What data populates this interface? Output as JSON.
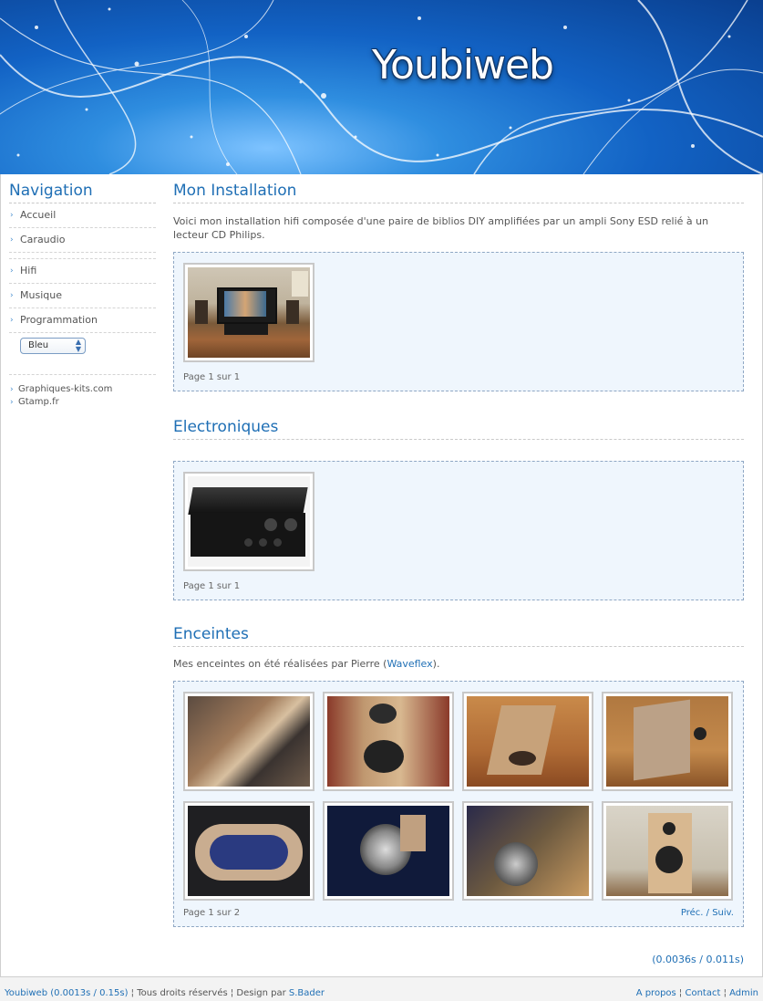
{
  "header": {
    "site_title": "Youbiweb"
  },
  "sidebar": {
    "title": "Navigation",
    "items": [
      {
        "label": "Accueil"
      },
      {
        "label": "Caraudio"
      },
      {
        "label": "Hifi"
      },
      {
        "label": "Musique"
      },
      {
        "label": "Programmation"
      }
    ],
    "theme_select": {
      "selected": "Bleu"
    },
    "links": [
      {
        "label": "Graphiques-kits.com"
      },
      {
        "label": "Gtamp.fr"
      }
    ]
  },
  "sections": [
    {
      "title": "Mon Installation",
      "intro": "Voici mon installation hifi composée d'une paire de biblios DIY amplifiées par un ampli Sony ESD relié à un lecteur CD Philips.",
      "page_info": "Page 1 sur 1"
    },
    {
      "title": "Electroniques",
      "page_info": "Page 1 sur 1"
    },
    {
      "title": "Enceintes",
      "intro_before": "Mes enceintes on été réalisées par Pierre (",
      "intro_link": "Waveflex",
      "intro_after": ").",
      "page_info": "Page 1 sur 2",
      "prev_label": "Préc.",
      "sep": "/",
      "next_label": "Suiv."
    }
  ],
  "timing": {
    "open": "(",
    "t1": "0.0036s",
    "sep": " / ",
    "t2": "0.011s",
    "close": ")"
  },
  "footer": {
    "site": "Youbiweb",
    "t_open": " (",
    "t1": "0.0013s",
    "t_sep": " / ",
    "t2": "0.15s",
    "t_close": ")",
    "rights": " ¦ Tous droits réservés ¦ Design par ",
    "designer": "S.Bader",
    "links": [
      "A propos",
      "Contact",
      "Admin"
    ],
    "link_sep": " ¦ "
  },
  "colors": {
    "accent": "#1f6fb5",
    "gallery_bg": "#eff6fd",
    "header_blue": "#1262c4"
  }
}
